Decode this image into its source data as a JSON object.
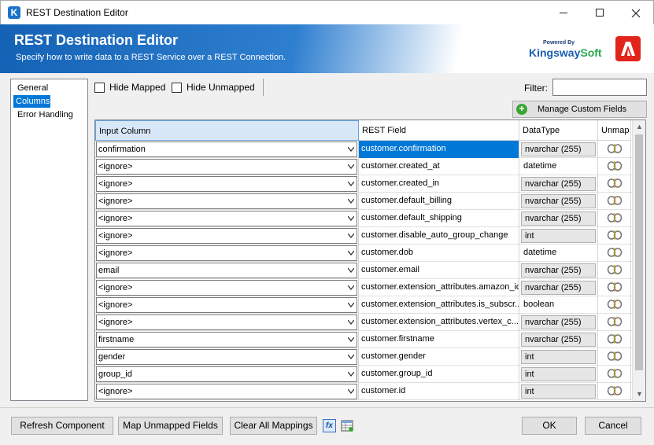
{
  "window": {
    "title": "REST Destination Editor"
  },
  "banner": {
    "title": "REST Destination Editor",
    "subtitle": "Specify how to write data to a REST Service over a REST Connection.",
    "logo_powered": "Powered By",
    "logo_brand_a": "Kingsway",
    "logo_brand_b": "Soft"
  },
  "nav": {
    "items": [
      {
        "label": "General",
        "selected": false
      },
      {
        "label": "Columns",
        "selected": true
      },
      {
        "label": "Error Handling",
        "selected": false
      }
    ]
  },
  "options": {
    "hide_mapped": "Hide Mapped",
    "hide_unmapped": "Hide Unmapped",
    "filter_label": "Filter:",
    "filter_value": "",
    "manage_custom_fields": "Manage Custom Fields"
  },
  "grid": {
    "headers": {
      "input_column": "Input Column",
      "rest_field": "REST Field",
      "datatype": "DataType",
      "unmap": "Unmap"
    },
    "rows": [
      {
        "input": "confirmation",
        "rest": "customer.confirmation",
        "dtype": "nvarchar (255)",
        "boxed": true
      },
      {
        "input": "<ignore>",
        "rest": "customer.created_at",
        "dtype": "datetime",
        "boxed": false
      },
      {
        "input": "<ignore>",
        "rest": "customer.created_in",
        "dtype": "nvarchar (255)",
        "boxed": true
      },
      {
        "input": "<ignore>",
        "rest": "customer.default_billing",
        "dtype": "nvarchar (255)",
        "boxed": true
      },
      {
        "input": "<ignore>",
        "rest": "customer.default_shipping",
        "dtype": "nvarchar (255)",
        "boxed": true
      },
      {
        "input": "<ignore>",
        "rest": "customer.disable_auto_group_change",
        "dtype": "int",
        "boxed": true
      },
      {
        "input": "<ignore>",
        "rest": "customer.dob",
        "dtype": "datetime",
        "boxed": false
      },
      {
        "input": "email",
        "rest": "customer.email",
        "dtype": "nvarchar (255)",
        "boxed": true
      },
      {
        "input": "<ignore>",
        "rest": "customer.extension_attributes.amazon_id",
        "dtype": "nvarchar (255)",
        "boxed": true
      },
      {
        "input": "<ignore>",
        "rest": "customer.extension_attributes.is_subscr...",
        "dtype": "boolean",
        "boxed": false
      },
      {
        "input": "<ignore>",
        "rest": "customer.extension_attributes.vertex_c...",
        "dtype": "nvarchar (255)",
        "boxed": true
      },
      {
        "input": "firstname",
        "rest": "customer.firstname",
        "dtype": "nvarchar (255)",
        "boxed": true
      },
      {
        "input": "gender",
        "rest": "customer.gender",
        "dtype": "int",
        "boxed": true
      },
      {
        "input": "group_id",
        "rest": "customer.group_id",
        "dtype": "int",
        "boxed": true
      },
      {
        "input": "<ignore>",
        "rest": "customer.id",
        "dtype": "int",
        "boxed": true
      }
    ]
  },
  "buttons": {
    "refresh": "Refresh Component",
    "map_unmapped": "Map Unmapped Fields",
    "clear_all": "Clear All Mappings",
    "fx": "fx",
    "ok": "OK",
    "cancel": "Cancel"
  }
}
